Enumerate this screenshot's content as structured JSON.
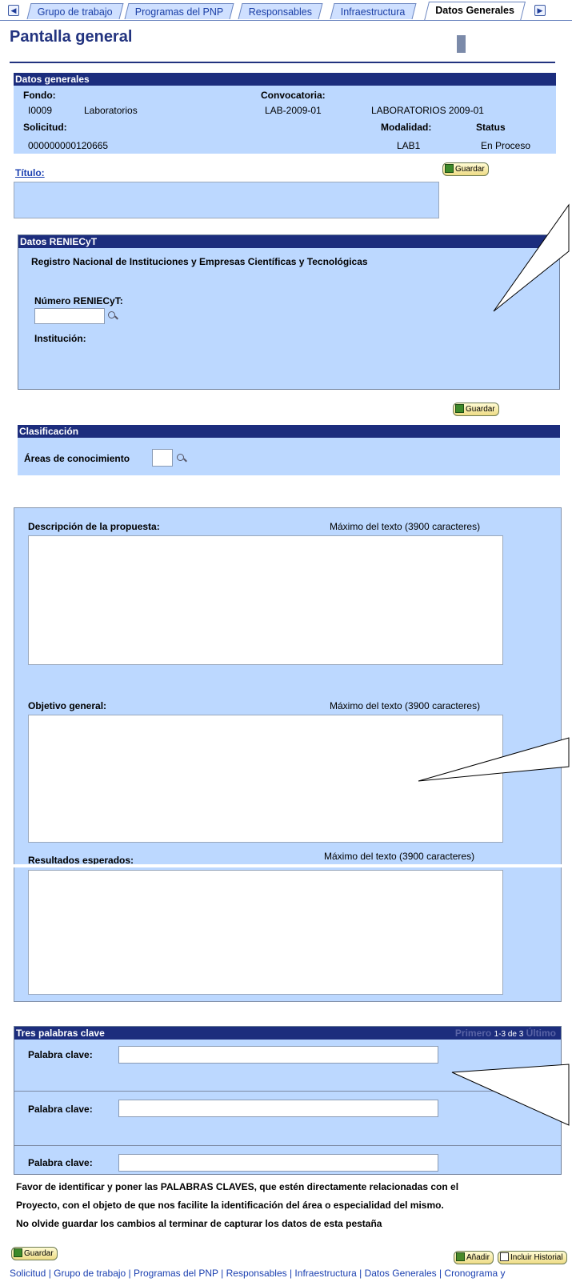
{
  "tabs": [
    "Grupo de trabajo",
    "Programas del PNP",
    "Responsables",
    "Infraestructura",
    "Datos Generales"
  ],
  "tab_nav": {
    "prev_icon": "arrow-left-icon",
    "next_icon": "arrow-right-icon"
  },
  "page_title": "Pantalla general",
  "datos_generales": {
    "header": "Datos generales",
    "fondo_label": "Fondo:",
    "fondo_code": "I0009",
    "fondo_name": "Laboratorios",
    "convocatoria_label": "Convocatoria:",
    "convocatoria_code": "LAB-2009-01",
    "convocatoria_name": "LABORATORIOS 2009-01",
    "solicitud_label": "Solicitud:",
    "solicitud_value": "000000000120665",
    "modalidad_label": "Modalidad:",
    "modalidad_value": "LAB1",
    "status_label": "Status",
    "status_value": "En Proceso"
  },
  "titulo": {
    "label": "Título:",
    "value": ""
  },
  "buttons": {
    "guardar": "Guardar",
    "anadir": "Añadir",
    "incluir_historial": "Incluir Historial"
  },
  "reniecyt": {
    "header": "Datos RENIECyT",
    "description": "Registro Nacional de Instituciones y Empresas Científicas y Tecnológicas",
    "numero_label": "Número RENIECyT:",
    "numero_value": "",
    "institucion_label": "Institución:"
  },
  "clasificacion": {
    "header": "Clasificación",
    "areas_label": "Áreas de conocimiento",
    "areas_value": ""
  },
  "propuesta": {
    "descripcion_label": "Descripción de la propuesta:",
    "objetivo_label": "Objetivo general:",
    "resultados_label": "Resultados esperados:",
    "max_text": "Máximo del texto (3900 caracteres)"
  },
  "palabras": {
    "header": "Tres palabras clave",
    "nav_first": "Primero",
    "nav_range": "1-3 de 3",
    "nav_last": "Último",
    "label": "Palabra clave:",
    "values": [
      "",
      "",
      ""
    ]
  },
  "instructions": [
    "Favor de identificar y poner las PALABRAS CLAVES, que estén directamente relacionadas con el",
    "Proyecto, con el objeto de que nos facilite la identificación del área o especialidad del mismo.",
    "No olvide guardar los cambios al terminar de capturar los datos de esta pestaña"
  ],
  "bottom_nav": "Solicitud | Grupo de trabajo | Programas del PNP | Responsables | Infraestructura | Datos Generales | Cronograma y"
}
